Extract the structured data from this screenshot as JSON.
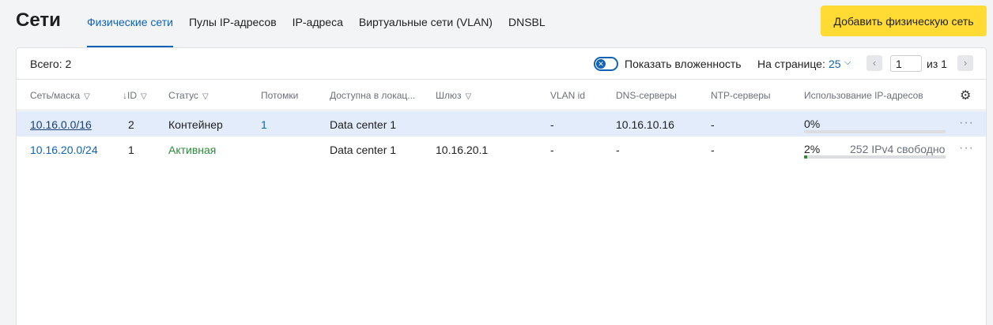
{
  "header": {
    "title": "Сети",
    "tabs": [
      {
        "label": "Физические сети"
      },
      {
        "label": "Пулы IP-адресов"
      },
      {
        "label": "IP-адреса"
      },
      {
        "label": "Виртуальные сети (VLAN)"
      },
      {
        "label": "DNSBL"
      }
    ],
    "add_button": "Добавить физическую сеть"
  },
  "toolbar": {
    "total": "Всего: 2",
    "nesting_label": "Показать вложенность",
    "per_page_label": "На странице:",
    "per_page_value": "25",
    "page_value": "1",
    "page_of": "из  1"
  },
  "columns": {
    "network": "Сеть/маска",
    "id": "ID",
    "id_sort": "↓",
    "status": "Статус",
    "children": "Потомки",
    "location": "Доступна в локац...",
    "gateway": "Шлюз",
    "vlan": "VLAN id",
    "dns": "DNS-серверы",
    "ntp": "NTP-серверы",
    "usage": "Использование IP-адресов"
  },
  "rows": [
    {
      "network": "10.16.0.0/16",
      "id": "2",
      "status": "Контейнер",
      "children": "1",
      "location": "Data center 1",
      "gateway": "",
      "vlan": "-",
      "dns": "10.16.10.16",
      "ntp": "-",
      "usage_pct": "0%",
      "usage_free": "",
      "usage_fraction": 0
    },
    {
      "network": "10.16.20.0/24",
      "id": "1",
      "status": "Активная",
      "children": "",
      "location": "Data center 1",
      "gateway": "10.16.20.1",
      "vlan": "-",
      "dns": "-",
      "ntp": "-",
      "usage_pct": "2%",
      "usage_free": "252 IPv4 свободно",
      "usage_fraction": 0.02
    }
  ],
  "colors": {
    "accent": "#0f62b4",
    "button": "#ffdb34",
    "selected_row": "#e2ecfb",
    "active_status": "#2f8a3c"
  },
  "icons": [
    "filter-icon",
    "settings-gear-icon",
    "more-dots-icon",
    "chevron-left-icon",
    "chevron-right-icon",
    "chevron-down-icon",
    "toggle-close-icon"
  ]
}
